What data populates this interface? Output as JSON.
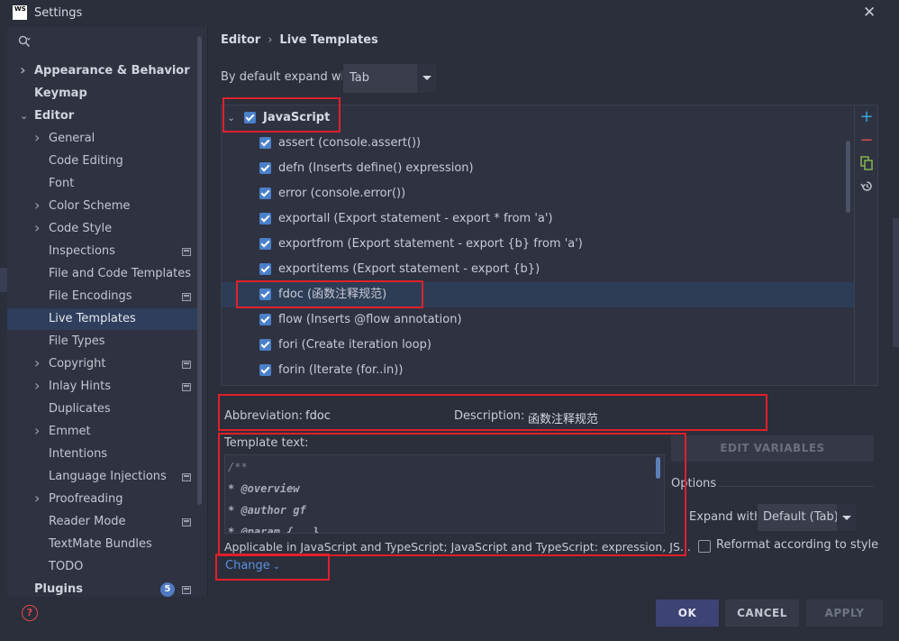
{
  "window": {
    "title": "Settings",
    "app_logo": "WS"
  },
  "sidebar": {
    "items": [
      {
        "label": "Appearance & Behavior",
        "bold": true,
        "chevron": "right"
      },
      {
        "label": "Keymap",
        "bold": true
      },
      {
        "label": "Editor",
        "bold": true,
        "chevron": "down"
      },
      {
        "label": "General",
        "chevron": "right"
      },
      {
        "label": "Code Editing"
      },
      {
        "label": "Font"
      },
      {
        "label": "Color Scheme",
        "chevron": "right"
      },
      {
        "label": "Code Style",
        "chevron": "right"
      },
      {
        "label": "Inspections",
        "project_icon": true
      },
      {
        "label": "File and Code Templates"
      },
      {
        "label": "File Encodings",
        "project_icon": true
      },
      {
        "label": "Live Templates",
        "selected": true
      },
      {
        "label": "File Types"
      },
      {
        "label": "Copyright",
        "chevron": "right",
        "project_icon": true
      },
      {
        "label": "Inlay Hints",
        "chevron": "right",
        "project_icon": true
      },
      {
        "label": "Duplicates"
      },
      {
        "label": "Emmet",
        "chevron": "right"
      },
      {
        "label": "Intentions"
      },
      {
        "label": "Language Injections",
        "project_icon": true
      },
      {
        "label": "Proofreading",
        "chevron": "right"
      },
      {
        "label": "Reader Mode",
        "project_icon": true
      },
      {
        "label": "TextMate Bundles"
      },
      {
        "label": "TODO"
      },
      {
        "label": "Plugins",
        "bold": true,
        "badge": "5",
        "project_icon": true
      }
    ]
  },
  "breadcrumb": {
    "parent": "Editor",
    "sep": "›",
    "current": "Live Templates"
  },
  "expand": {
    "label": "By default expand with",
    "value": "Tab"
  },
  "templates": {
    "group": {
      "label": "JavaScript",
      "checked": true
    },
    "items": [
      {
        "label": "assert (console.assert())",
        "checked": true
      },
      {
        "label": "defn (Inserts define() expression)",
        "checked": true
      },
      {
        "label": "error (console.error())",
        "checked": true
      },
      {
        "label": "exportall (Export statement - export * from 'a')",
        "checked": true
      },
      {
        "label": "exportfrom (Export statement - export {b} from 'a')",
        "checked": true
      },
      {
        "label": "exportitems (Export statement - export {b})",
        "checked": true
      },
      {
        "label": "fdoc (函数注释规范)",
        "checked": true,
        "selected": true
      },
      {
        "label": "flow (Inserts @flow annotation)",
        "checked": true
      },
      {
        "label": "fori (Create iteration loop)",
        "checked": true
      },
      {
        "label": "forin (Iterate (for..in))",
        "checked": true
      }
    ]
  },
  "toolbar": {
    "add": "+",
    "remove": "−"
  },
  "details": {
    "abbreviation_label": "Abbreviation:",
    "abbreviation_value": "fdoc",
    "description_label": "Description:",
    "description_value": "函数注释规范",
    "template_text_label": "Template text:",
    "code_lines": [
      "/**",
      "* @overview",
      "* @author gf",
      "* @param {...}"
    ],
    "applicable": "Applicable in JavaScript and TypeScript; JavaScript and TypeScript: expression, JS...",
    "change_link": "Change"
  },
  "options": {
    "edit_variables": "EDIT VARIABLES",
    "title": "Options",
    "expand_with_label": "Expand with",
    "expand_with_value": "Default (Tab)",
    "reformat_label": "Reformat according to style"
  },
  "footer": {
    "ok": "OK",
    "cancel": "CANCEL",
    "apply": "APPLY"
  },
  "colors": {
    "accent": "#4a80c9",
    "highlight": "#e0202a",
    "selection": "#2e3d56"
  }
}
